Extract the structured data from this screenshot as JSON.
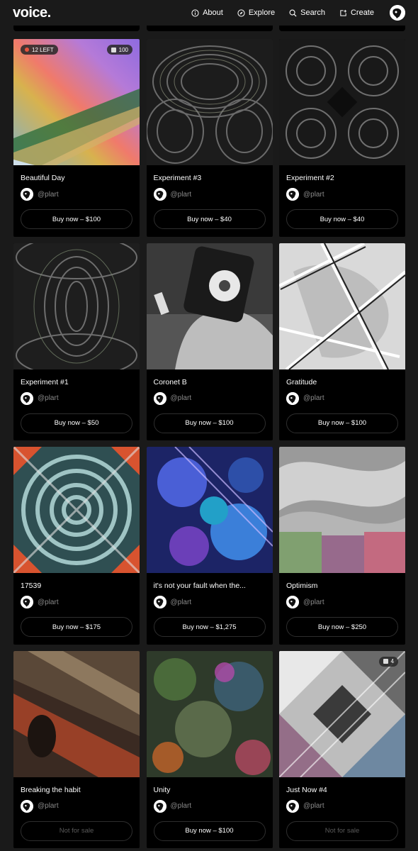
{
  "header": {
    "logo": "voice.",
    "nav": [
      {
        "label": "About",
        "icon": "info-icon"
      },
      {
        "label": "Explore",
        "icon": "compass-icon"
      },
      {
        "label": "Search",
        "icon": "search-icon"
      },
      {
        "label": "Create",
        "icon": "create-icon"
      }
    ]
  },
  "cards": [
    {
      "title": "Beautiful Day",
      "creator": "@plart",
      "action": "Buy now – $100",
      "left_badge": "12 LEFT",
      "edition_badge": "100"
    },
    {
      "title": "Experiment #3",
      "creator": "@plart",
      "action": "Buy now – $40"
    },
    {
      "title": "Experiment #2",
      "creator": "@plart",
      "action": "Buy now – $40"
    },
    {
      "title": "Experiment #1",
      "creator": "@plart",
      "action": "Buy now – $50"
    },
    {
      "title": "Coronet B",
      "creator": "@plart",
      "action": "Buy now – $100"
    },
    {
      "title": "Gratitude",
      "creator": "@plart",
      "action": "Buy now – $100"
    },
    {
      "title": "17539",
      "creator": "@plart",
      "action": "Buy now – $175"
    },
    {
      "title": "it's not your fault when the...",
      "creator": "@plart",
      "action": "Buy now – $1,275"
    },
    {
      "title": "Optimism",
      "creator": "@plart",
      "action": "Buy now – $250"
    },
    {
      "title": "Breaking the habit",
      "creator": "@plart",
      "action": "Not for sale"
    },
    {
      "title": "Unity",
      "creator": "@plart",
      "action": "Buy now – $100"
    },
    {
      "title": "Just Now #4",
      "creator": "@plart",
      "action": "Not for sale",
      "edition_badge": "4"
    }
  ],
  "colors": {
    "page_bg": "#1a1a1a",
    "card_bg": "#000000",
    "muted_text": "#8a8a8a",
    "badge_dot": "#e5533d"
  }
}
